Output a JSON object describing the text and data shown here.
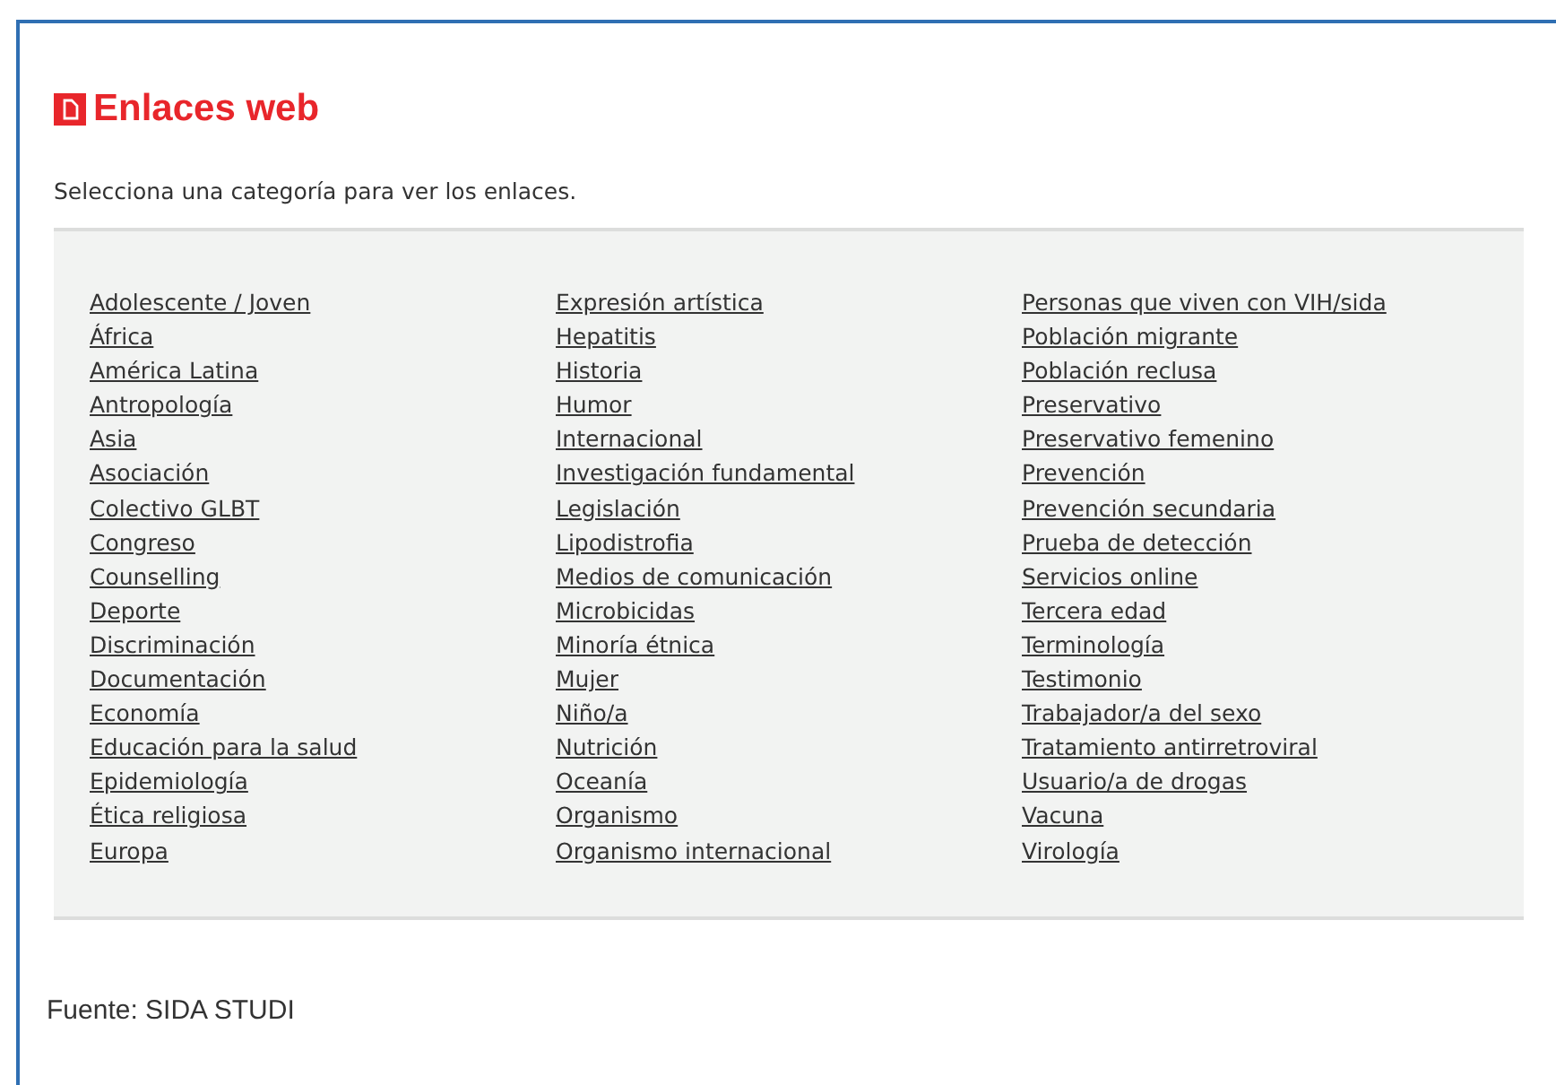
{
  "title": "Enlaces web",
  "intro": "Selecciona una categoría para ver los enlaces.",
  "columns": [
    [
      "Adolescente / Joven",
      "África",
      "América Latina",
      "Antropología",
      "Asia",
      "Asociación",
      "Colectivo GLBT",
      "Congreso",
      "Counselling",
      "Deporte",
      "Discriminación",
      "Documentación",
      "Economía",
      "Educación para la salud",
      "Epidemiología",
      "Ética religiosa",
      "Europa"
    ],
    [
      "Expresión artística",
      "Hepatitis",
      "Historia",
      "Humor",
      "Internacional",
      "Investigación fundamental",
      "Legislación",
      "Lipodistrofia",
      "Medios de comunicación",
      "Microbicidas",
      "Minoría étnica",
      "Mujer",
      "Niño/a",
      "Nutrición",
      "Oceanía",
      "Organismo",
      "Organismo internacional"
    ],
    [
      "Personas que viven con VIH/sida",
      "Población migrante",
      "Población reclusa",
      "Preservativo",
      "Preservativo femenino",
      "Prevención",
      "Prevención secundaria",
      "Prueba de detección",
      "Servicios online",
      "Tercera edad",
      "Terminología",
      "Testimonio",
      "Trabajador/a del sexo",
      "Tratamiento antirretroviral",
      "Usuario/a de drogas",
      "Vacuna",
      "Virología"
    ]
  ],
  "source": "Fuente: SIDA STUDI"
}
